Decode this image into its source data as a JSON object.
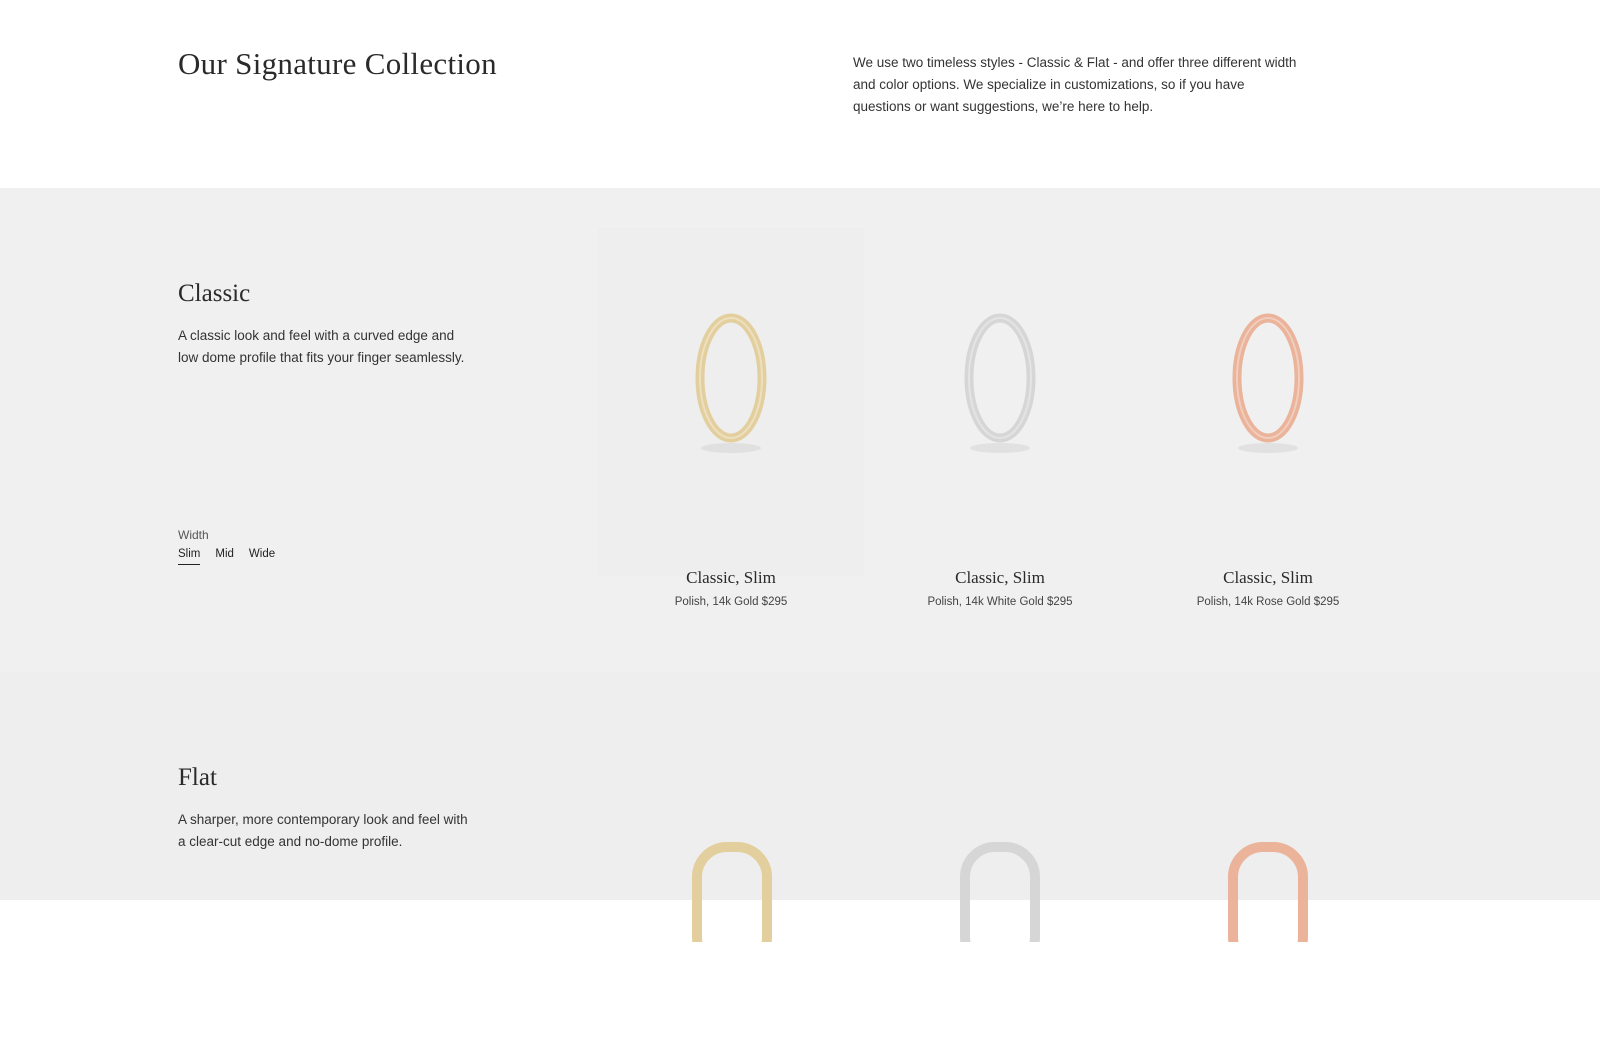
{
  "header": {
    "title": "Our Signature Collection",
    "intro": "We use two timeless styles - Classic & Flat - and offer three different width and color options. We specialize in customizations, so if you have questions or want suggestions, we’re here to help."
  },
  "classic": {
    "title": "Classic",
    "description": "A classic look and feel with a curved edge and low dome profile that fits your finger seamlessly.",
    "width_label": "Width",
    "width_options": [
      "Slim",
      "Mid",
      "Wide"
    ],
    "selected_width": "Slim",
    "products": [
      {
        "name": "Classic, Slim",
        "detail": "Polish, 14k Gold $295",
        "metal_color": "#e3cf9e"
      },
      {
        "name": "Classic, Slim",
        "detail": "Polish, 14k White Gold $295",
        "metal_color": "#d6d6d6"
      },
      {
        "name": "Classic, Slim",
        "detail": "Polish, 14k Rose Gold $295",
        "metal_color": "#eab39a"
      }
    ]
  },
  "flat": {
    "title": "Flat",
    "description": "A sharper, more contemporary look and feel with a clear-cut edge and no-dome profile.",
    "products": [
      {
        "metal_color": "#e3cf9e"
      },
      {
        "metal_color": "#d6d6d6"
      },
      {
        "metal_color": "#eab39a"
      }
    ]
  }
}
